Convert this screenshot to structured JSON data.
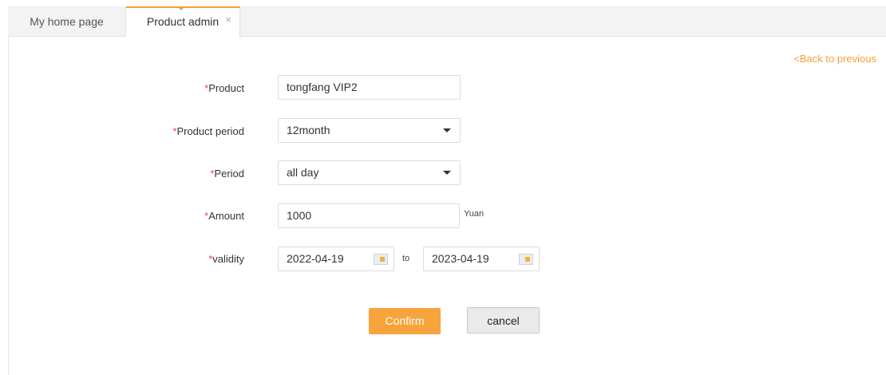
{
  "tabs": {
    "home_label": "My home page",
    "product_label": "Product admin",
    "close_symbol": "×"
  },
  "back_link": "<Back to previous",
  "form": {
    "required_mark": "*",
    "product": {
      "label": "Product",
      "value": "tongfang VIP2"
    },
    "product_period": {
      "label": "Product period",
      "value": "12month"
    },
    "period": {
      "label": "Period",
      "value": "all day"
    },
    "amount": {
      "label": "Amount",
      "value": "1000",
      "unit": "Yuan"
    },
    "validity": {
      "label": "validity",
      "start": "2022-04-19",
      "to": "to",
      "end": "2023-04-19"
    }
  },
  "buttons": {
    "confirm": "Confirm",
    "cancel": "cancel"
  },
  "colors": {
    "accent": "#f5a03a",
    "required": "#e64a3b"
  },
  "icons": [
    "close-icon",
    "dropdown-caret-icon",
    "calendar-icon"
  ]
}
